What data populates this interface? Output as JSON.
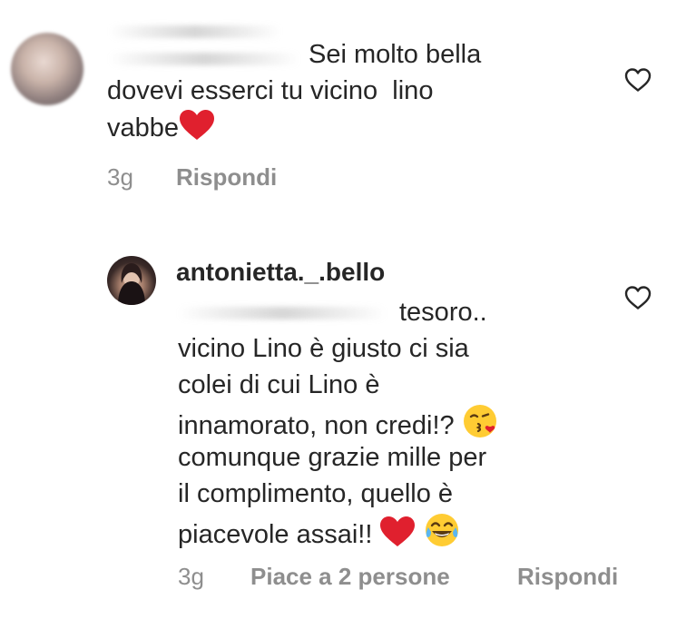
{
  "comments": [
    {
      "id": "comment-1",
      "lines": [
        "Sei molto bella",
        "dovevi esserci tu vicino  lino",
        "vabbe"
      ],
      "time": "3g",
      "reply_label": "Rispondi"
    },
    {
      "id": "comment-2",
      "username": "antonietta._.bello",
      "lines": [
        "tesoro..",
        "vicino Lino è giusto ci sia",
        "colei di cui Lino è",
        "innamorato, non credi!?",
        "comunque grazie mille per",
        "il complimento, quello è",
        "piacevole assai!!"
      ],
      "time": "3g",
      "likes_label": "Piace a 2 persone",
      "reply_label": "Rispondi"
    }
  ],
  "icons": {
    "heart_outline": "heart-outline-icon",
    "emoji_heart": "red-heart-emoji",
    "emoji_kiss": "kissing-face-emoji",
    "emoji_laugh": "tears-of-joy-emoji"
  },
  "colors": {
    "text": "#262626",
    "meta": "#8e8e8e",
    "heart_red": "#e0202e"
  }
}
